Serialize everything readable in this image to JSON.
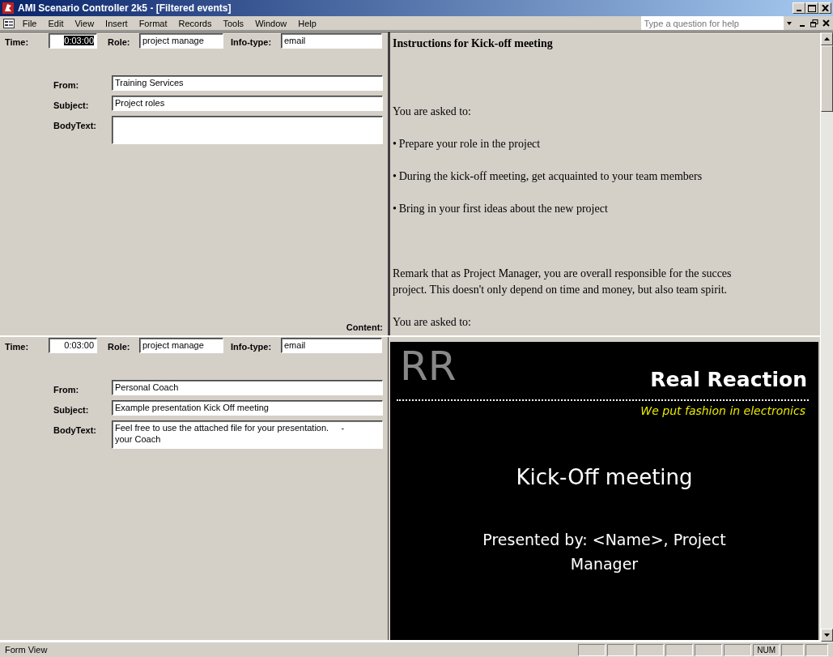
{
  "window": {
    "title": "AMI Scenario Controller 2k5 - [Filtered events]"
  },
  "menu": {
    "items": [
      "File",
      "Edit",
      "View",
      "Insert",
      "Format",
      "Records",
      "Tools",
      "Window",
      "Help"
    ],
    "help_box": {
      "placeholder": "Type a question for help"
    }
  },
  "records": [
    {
      "time_label": "Time:",
      "time": {
        "value": "0:03:00",
        "selected": true
      },
      "role_label": "Role:",
      "role": "project manage",
      "info_type_label": "Info-type:",
      "info_type": "email",
      "from_label": "From:",
      "from": "Training Services",
      "subject_label": "Subject:",
      "subject": "Project roles",
      "body_label": "BodyText:",
      "content_label": "Content:",
      "preview": {
        "kind": "instructions",
        "heading": "Instructions for Kick-off meeting",
        "paragraphs": [
          {
            "kind": "text",
            "text": "You are asked to:"
          },
          {
            "kind": "bullet",
            "bullet": "•",
            "text": "Prepare your role in the project"
          },
          {
            "kind": "bullet",
            "bullet": "•",
            "text": "During the kick-off meeting, get acquainted to your team members"
          },
          {
            "kind": "bullet",
            "bullet": "•",
            "text": "Bring in your first ideas about the new project"
          },
          {
            "kind": "text",
            "text": "Remark that as Project Manager, you are overall responsible for the succes"
          },
          {
            "kind": "line",
            "text": "project. This doesn't only depend on time and money, but also team spirit."
          },
          {
            "kind": "text",
            "text": "You are asked to:"
          }
        ]
      }
    },
    {
      "time_label": "Time:",
      "time": {
        "value": "0:03:00",
        "selected": false
      },
      "role_label": "Role:",
      "role": "project manage",
      "info_type_label": "Info-type:",
      "info_type": "email",
      "from_label": "From:",
      "from": "Personal Coach",
      "subject_label": "Subject:",
      "subject": "Example presentation Kick Off meeting",
      "body_label": "BodyText:",
      "body": "Feel free to use the attached file for your presentation.     -\nyour Coach",
      "preview": {
        "kind": "slide",
        "logo": "RR",
        "company": "Real Reaction",
        "tagline": "We put fashion in electronics",
        "title": "Kick-Off meeting",
        "subtitle": "Presented by: <Name>, Project Manager"
      }
    }
  ],
  "status_bar": {
    "text": "Form View",
    "indicator": "NUM"
  }
}
